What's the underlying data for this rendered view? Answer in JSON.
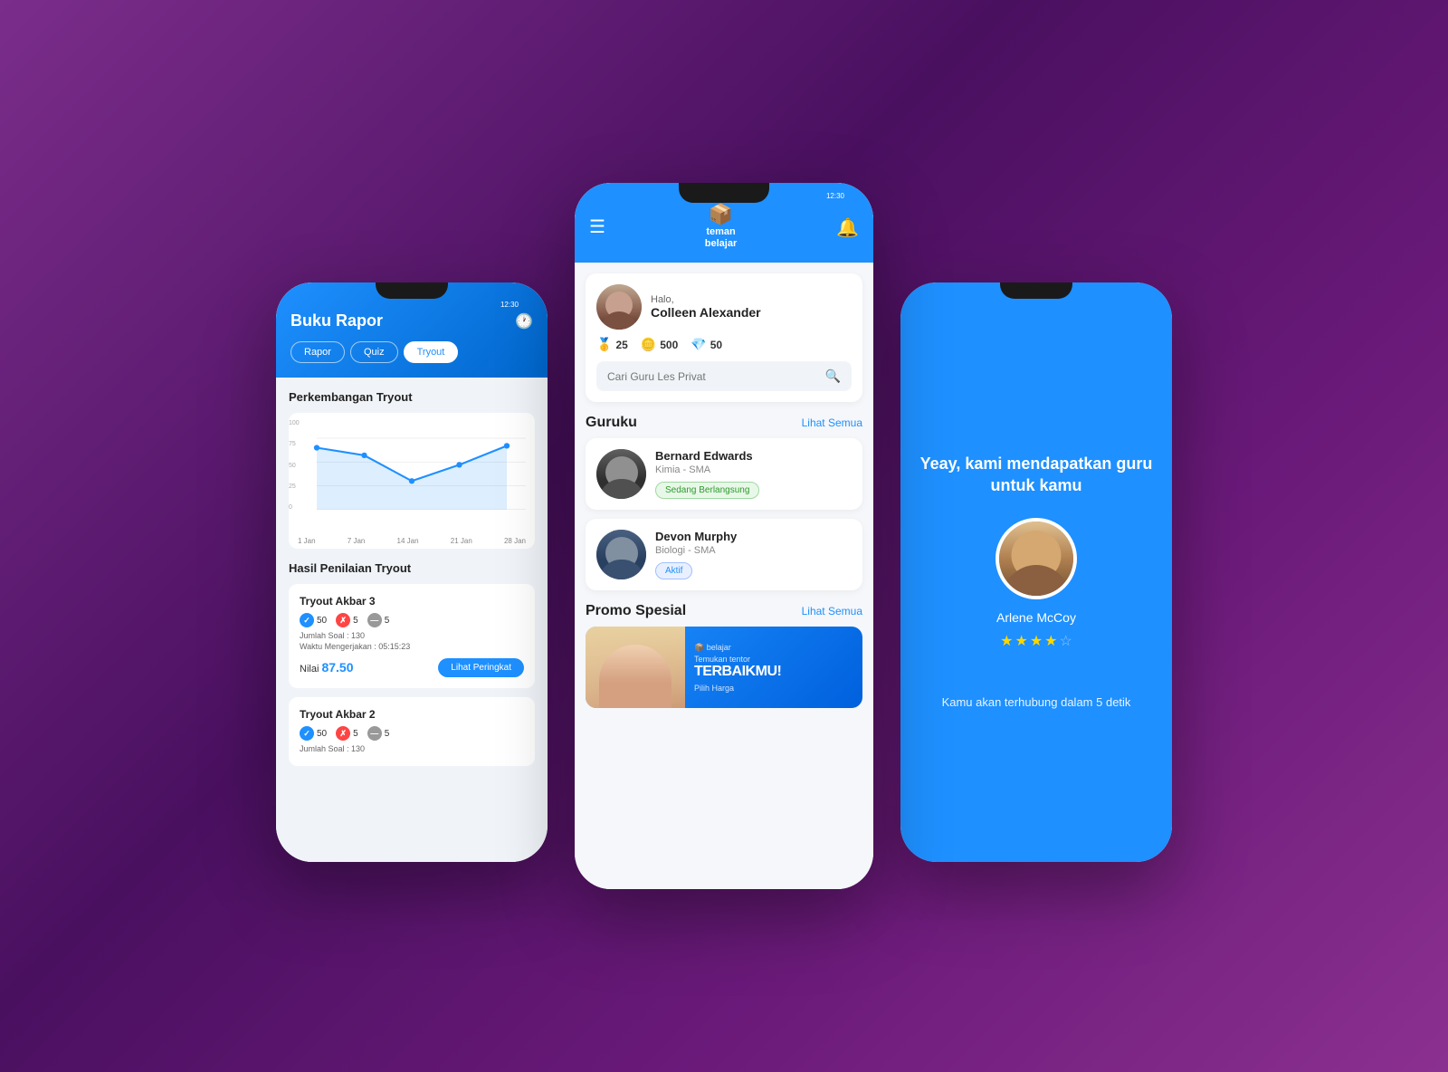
{
  "left_phone": {
    "header": {
      "title": "Buku Rapor",
      "tabs": [
        {
          "label": "Rapor",
          "active": false
        },
        {
          "label": "Quiz",
          "active": false
        },
        {
          "label": "Tryout",
          "active": true
        }
      ]
    },
    "chart": {
      "title": "Perkembangan Tryout",
      "y_labels": [
        "100",
        "75",
        "50",
        "25",
        "0"
      ],
      "x_labels": [
        "1 Jan",
        "7 Jan",
        "14 Jan",
        "21 Jan",
        "28 Jan"
      ]
    },
    "results_title": "Hasil Penilaian Tryout",
    "tryouts": [
      {
        "name": "Tryout Akbar 3",
        "correct": 50,
        "wrong": 5,
        "skip": 5,
        "jumlah_soal": 130,
        "waktu": "05:15:23",
        "nilai": "87.50",
        "btn_label": "Lihat Peringkat"
      },
      {
        "name": "Tryout Akbar 2",
        "correct": 50,
        "wrong": 5,
        "skip": 5,
        "jumlah_soal": 130,
        "waktu": "",
        "nilai": "",
        "btn_label": ""
      }
    ]
  },
  "center_phone": {
    "header": {
      "logo_text_line1": "teman",
      "logo_text_line2": "belajar"
    },
    "user": {
      "greet": "Halo,",
      "name": "Colleen Alexander",
      "points": [
        {
          "emoji": "🏅",
          "value": "25"
        },
        {
          "emoji": "🪙",
          "value": "500"
        },
        {
          "emoji": "💎",
          "value": "50"
        }
      ]
    },
    "search_placeholder": "Cari Guru Les Privat",
    "guru_section": {
      "title": "Guruku",
      "link": "Lihat Semua",
      "teachers": [
        {
          "name": "Bernard Edwards",
          "subject": "Kimia - SMA",
          "status": "Sedang Berlangsung",
          "status_type": "active_session"
        },
        {
          "name": "Devon Murphy",
          "subject": "Biologi - SMA",
          "status": "Aktif",
          "status_type": "active"
        }
      ]
    },
    "promo_section": {
      "title": "Promo Spesial",
      "link": "Lihat Semua",
      "banner": {
        "small_text": "Temukan tentor",
        "big_text": "TERBAIKMU!",
        "sub_text": "Pilih Harga"
      }
    }
  },
  "right_phone": {
    "title": "Yeay, kami mendapatkan guru\nuntuk kamu",
    "guru": {
      "name": "Arlene McCoy",
      "rating": 3.5
    },
    "connect_text": "Kamu akan terhubung dalam 5 detik"
  }
}
